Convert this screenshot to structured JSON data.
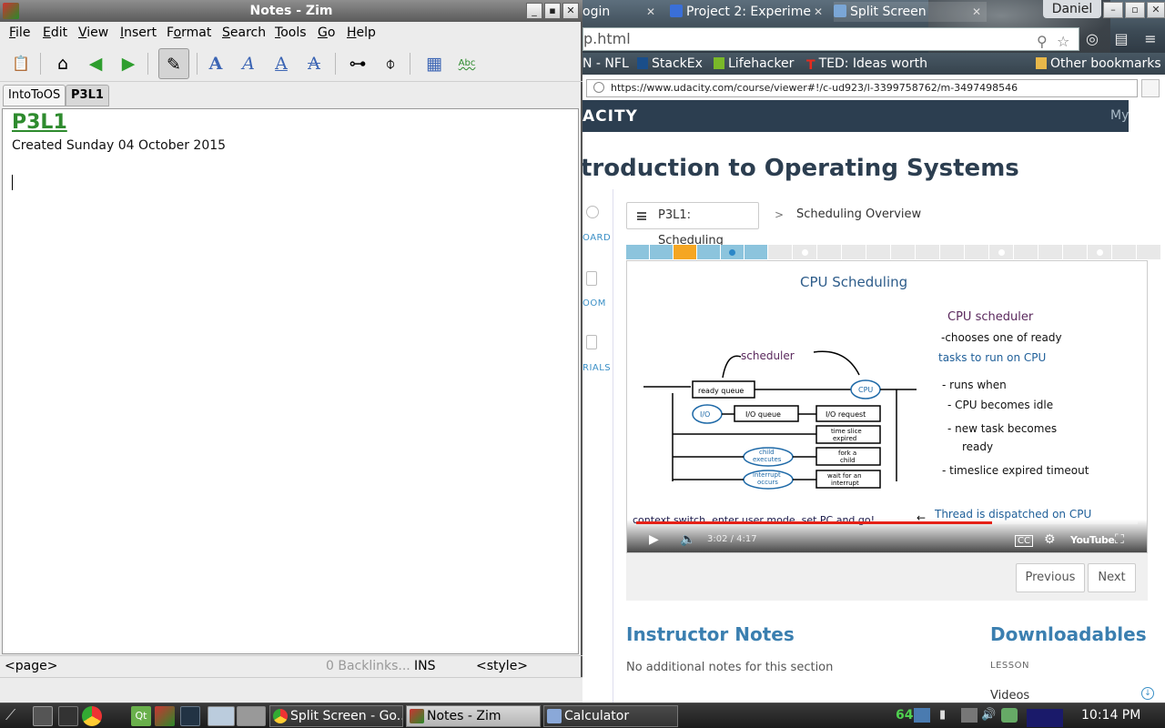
{
  "chrome": {
    "tabs": [
      {
        "label": "ogin",
        "active": false
      },
      {
        "label": "Project 2: Experime",
        "active": false
      },
      {
        "label": "Split Screen",
        "active": true
      }
    ],
    "profile": "Daniel",
    "url_partial": "p.html",
    "bookmarks": [
      "N - NFL",
      "StackEx",
      "Lifehacker",
      "TED: Ideas worth",
      "Other bookmarks"
    ],
    "inner_url": "https://www.udacity.com/course/viewer#!/c-ud923/l-3399758762/m-3497498546"
  },
  "udacity": {
    "brand": "ACITY",
    "my": "My",
    "course_title": "troduction to Operating Systems",
    "sidebar": [
      "OARD",
      "OOM",
      "RIALS"
    ],
    "lesson_button": "P3L1: Scheduling",
    "crumb_sep": ">",
    "crumb_current": "Scheduling Overview",
    "progress_colors": {
      "done": "#8cc4dd",
      "current": "#f5a623",
      "todo": "#e8e8e8",
      "dot_active": "#2b87c8"
    },
    "video": {
      "time": "3:02 / 4:17",
      "progress": 0.71,
      "youtube": "YouTube",
      "slide": {
        "title": "CPU Scheduling",
        "scheduler_label": "scheduler",
        "ready_queue": "ready queue",
        "cpu": "CPU",
        "io": "I/O",
        "io_queue": "I/O queue",
        "io_request": "I/O request",
        "time_slice": [
          "time slice",
          "expired"
        ],
        "child_executes": [
          "child",
          "executes"
        ],
        "fork_child": [
          "fork a",
          "child"
        ],
        "interrupt_occurs": [
          "interrupt",
          "occurs"
        ],
        "wait_interrupt": [
          "wait for an",
          "interrupt"
        ],
        "notes_title": "CPU scheduler",
        "notes": [
          "-chooses one of ready",
          "tasks to run on CPU",
          "- runs when",
          "- CPU becomes idle",
          "- new task becomes",
          "ready",
          "- timeslice expired timeout"
        ],
        "footer_left": "context switch, enter user mode, set PC and go!",
        "footer_arrow": "←",
        "footer_right": "Thread is dispatched on CPU"
      }
    },
    "previous": "Previous",
    "next": "Next",
    "instructor_title": "Instructor Notes",
    "instructor_text": "No additional notes for this section",
    "downloadables_title": "Downloadables",
    "downloadables_section": "LESSON",
    "downloadables_item": "Videos"
  },
  "zim": {
    "title": "Notes - Zim",
    "menus": [
      {
        "u": "F",
        "rest": "ile"
      },
      {
        "u": "E",
        "rest": "dit"
      },
      {
        "u": "V",
        "rest": "iew"
      },
      {
        "u": "I",
        "rest": "nsert"
      },
      {
        "pre": "F",
        "u": "o",
        "rest": "rmat"
      },
      {
        "u": "S",
        "rest": "earch"
      },
      {
        "u": "T",
        "rest": "ools"
      },
      {
        "u": "G",
        "rest": "o"
      },
      {
        "u": "H",
        "rest": "elp"
      }
    ],
    "tabs": [
      "IntoToOS",
      "P3L1"
    ],
    "page_heading": "P3L1",
    "created": "Created Sunday 04 October 2015",
    "status": {
      "page": "<page>",
      "backlinks": "0 Backlinks...",
      "mode": "INS",
      "style": "<style>"
    }
  },
  "taskbar": {
    "tasks": [
      "Split Screen - Go...",
      "Notes - Zim",
      "Calculator"
    ],
    "tray_number": "64",
    "clock": "10:14 PM"
  }
}
